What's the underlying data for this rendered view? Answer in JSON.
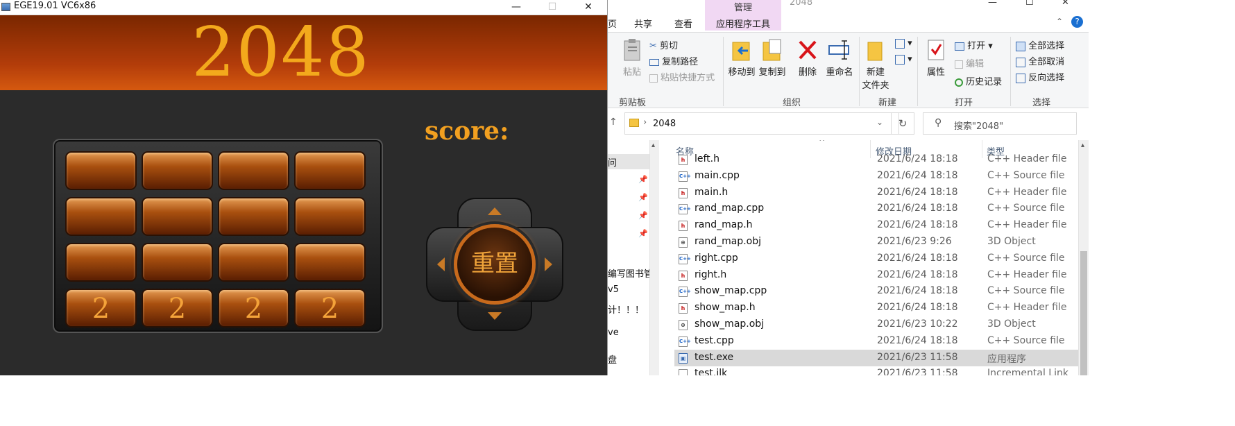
{
  "game_window": {
    "title": "EGE19.01 VC6x86",
    "minimize_glyph": "—",
    "maximize_glyph": "☐",
    "close_glyph": "✕",
    "banner_title": "2048",
    "score_label": "score:",
    "reset_label": "重置",
    "cells": [
      "",
      "",
      "",
      "",
      "",
      "",
      "",
      "",
      "",
      "",
      "",
      "",
      "2",
      "2",
      "2",
      "2"
    ],
    "accent": "#f3a91c"
  },
  "explorer": {
    "title_tab": "2048",
    "tabs": {
      "first_partial": "页",
      "share": "共享",
      "view": "查看"
    },
    "manage_tab": {
      "header": "管理",
      "label": "应用程序工具"
    },
    "window_glyphs": {
      "minimize": "—",
      "maximize": "☐",
      "close": "✕"
    },
    "ribbon": {
      "paste": "粘贴",
      "cut": "剪切",
      "copy_path": "复制路径",
      "paste_shortcut": "粘贴快捷方式",
      "clipboard_group": "剪贴板",
      "move_to": "移动到",
      "copy_to": "复制到",
      "delete": "删除",
      "rename": "重命名",
      "organize_group": "组织",
      "new_folder_line1": "新建",
      "new_folder_line2": "文件夹",
      "new_group": "新建",
      "properties": "属性",
      "open": "打开",
      "edit": "编辑",
      "history": "历史记录",
      "open_group": "打开",
      "select_all": "全部选择",
      "select_none": "全部取消",
      "invert_selection": "反向选择",
      "select_group": "选择"
    },
    "address": {
      "path": "2048"
    },
    "search": {
      "placeholder": "搜索\"2048\""
    },
    "nav_items": [
      "问",
      "编写图书管",
      "v5",
      "计！！！",
      "ve",
      "盘"
    ],
    "columns": {
      "name": "名称",
      "date": "修改日期",
      "type": "类型"
    },
    "files": [
      {
        "name": "left.h",
        "date": "2021/6/24 18:18",
        "type": "C++ Header file",
        "icon": "h"
      },
      {
        "name": "main.cpp",
        "date": "2021/6/24 18:18",
        "type": "C++ Source file",
        "icon": "cpp"
      },
      {
        "name": "main.h",
        "date": "2021/6/24 18:18",
        "type": "C++ Header file",
        "icon": "h"
      },
      {
        "name": "rand_map.cpp",
        "date": "2021/6/24 18:18",
        "type": "C++ Source file",
        "icon": "cpp"
      },
      {
        "name": "rand_map.h",
        "date": "2021/6/24 18:18",
        "type": "C++ Header file",
        "icon": "h"
      },
      {
        "name": "rand_map.obj",
        "date": "2021/6/23 9:26",
        "type": "3D Object",
        "icon": "obj"
      },
      {
        "name": "right.cpp",
        "date": "2021/6/24 18:18",
        "type": "C++ Source file",
        "icon": "cpp"
      },
      {
        "name": "right.h",
        "date": "2021/6/24 18:18",
        "type": "C++ Header file",
        "icon": "h"
      },
      {
        "name": "show_map.cpp",
        "date": "2021/6/24 18:18",
        "type": "C++ Source file",
        "icon": "cpp"
      },
      {
        "name": "show_map.h",
        "date": "2021/6/24 18:18",
        "type": "C++ Header file",
        "icon": "h"
      },
      {
        "name": "show_map.obj",
        "date": "2021/6/23 10:22",
        "type": "3D Object",
        "icon": "obj"
      },
      {
        "name": "test.cpp",
        "date": "2021/6/24 18:18",
        "type": "C++ Source file",
        "icon": "cpp"
      },
      {
        "name": "test.exe",
        "date": "2021/6/23 11:58",
        "type": "应用程序",
        "icon": "exe",
        "selected": true
      },
      {
        "name": "test.ilk",
        "date": "2021/6/23 11:58",
        "type": "Incremental Link",
        "icon": "ilk"
      }
    ]
  }
}
